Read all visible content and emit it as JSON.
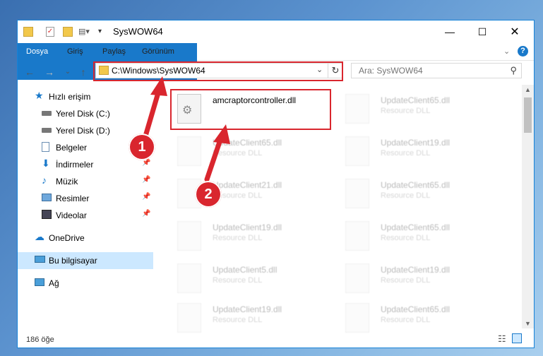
{
  "window": {
    "title": "SysWOW64"
  },
  "ribbon": {
    "tabs": [
      "Dosya",
      "Giriş",
      "Paylaş",
      "Görünüm"
    ]
  },
  "nav": {
    "address": "C:\\Windows\\SysWOW64",
    "search_placeholder": "Ara: SysWOW64"
  },
  "sidebar": {
    "items": [
      {
        "label": "Hızlı erişim",
        "icon": "star-icon"
      },
      {
        "label": "Yerel Disk (C:)",
        "icon": "drive-icon"
      },
      {
        "label": "Yerel Disk (D:)",
        "icon": "drive-icon"
      },
      {
        "label": "Belgeler",
        "icon": "documents-icon"
      },
      {
        "label": "İndirmeler",
        "icon": "download-icon"
      },
      {
        "label": "Müzik",
        "icon": "music-icon"
      },
      {
        "label": "Resimler",
        "icon": "pictures-icon"
      },
      {
        "label": "Videolar",
        "icon": "video-icon"
      },
      {
        "label": "OneDrive",
        "icon": "cloud-icon"
      },
      {
        "label": "Bu bilgisayar",
        "icon": "computer-icon"
      },
      {
        "label": "Ağ",
        "icon": "network-icon"
      }
    ]
  },
  "files": [
    {
      "name": "amcraptorcontroller.dll",
      "type": ""
    },
    {
      "name": "UpdateClient65.dll",
      "type": "Resource DLL"
    },
    {
      "name": "UpdateClient65.dll",
      "type": "Resource DLL"
    },
    {
      "name": "UpdateClient19.dll",
      "type": "Resource DLL"
    },
    {
      "name": "UpdateClient21.dll",
      "type": "Resource DLL"
    },
    {
      "name": "UpdateClient65.dll",
      "type": "Resource DLL"
    },
    {
      "name": "UpdateClient19.dll",
      "type": "Resource DLL"
    },
    {
      "name": "UpdateClient65.dll",
      "type": "Resource DLL"
    },
    {
      "name": "UpdateClient5.dll",
      "type": "Resource DLL"
    },
    {
      "name": "UpdateClient19.dll",
      "type": "Resource DLL"
    },
    {
      "name": "UpdateClient19.dll",
      "type": "Resource DLL"
    },
    {
      "name": "UpdateClient65.dll",
      "type": "Resource DLL"
    }
  ],
  "status": {
    "count": "186 öğe"
  },
  "annotations": {
    "step1": "1",
    "step2": "2"
  }
}
